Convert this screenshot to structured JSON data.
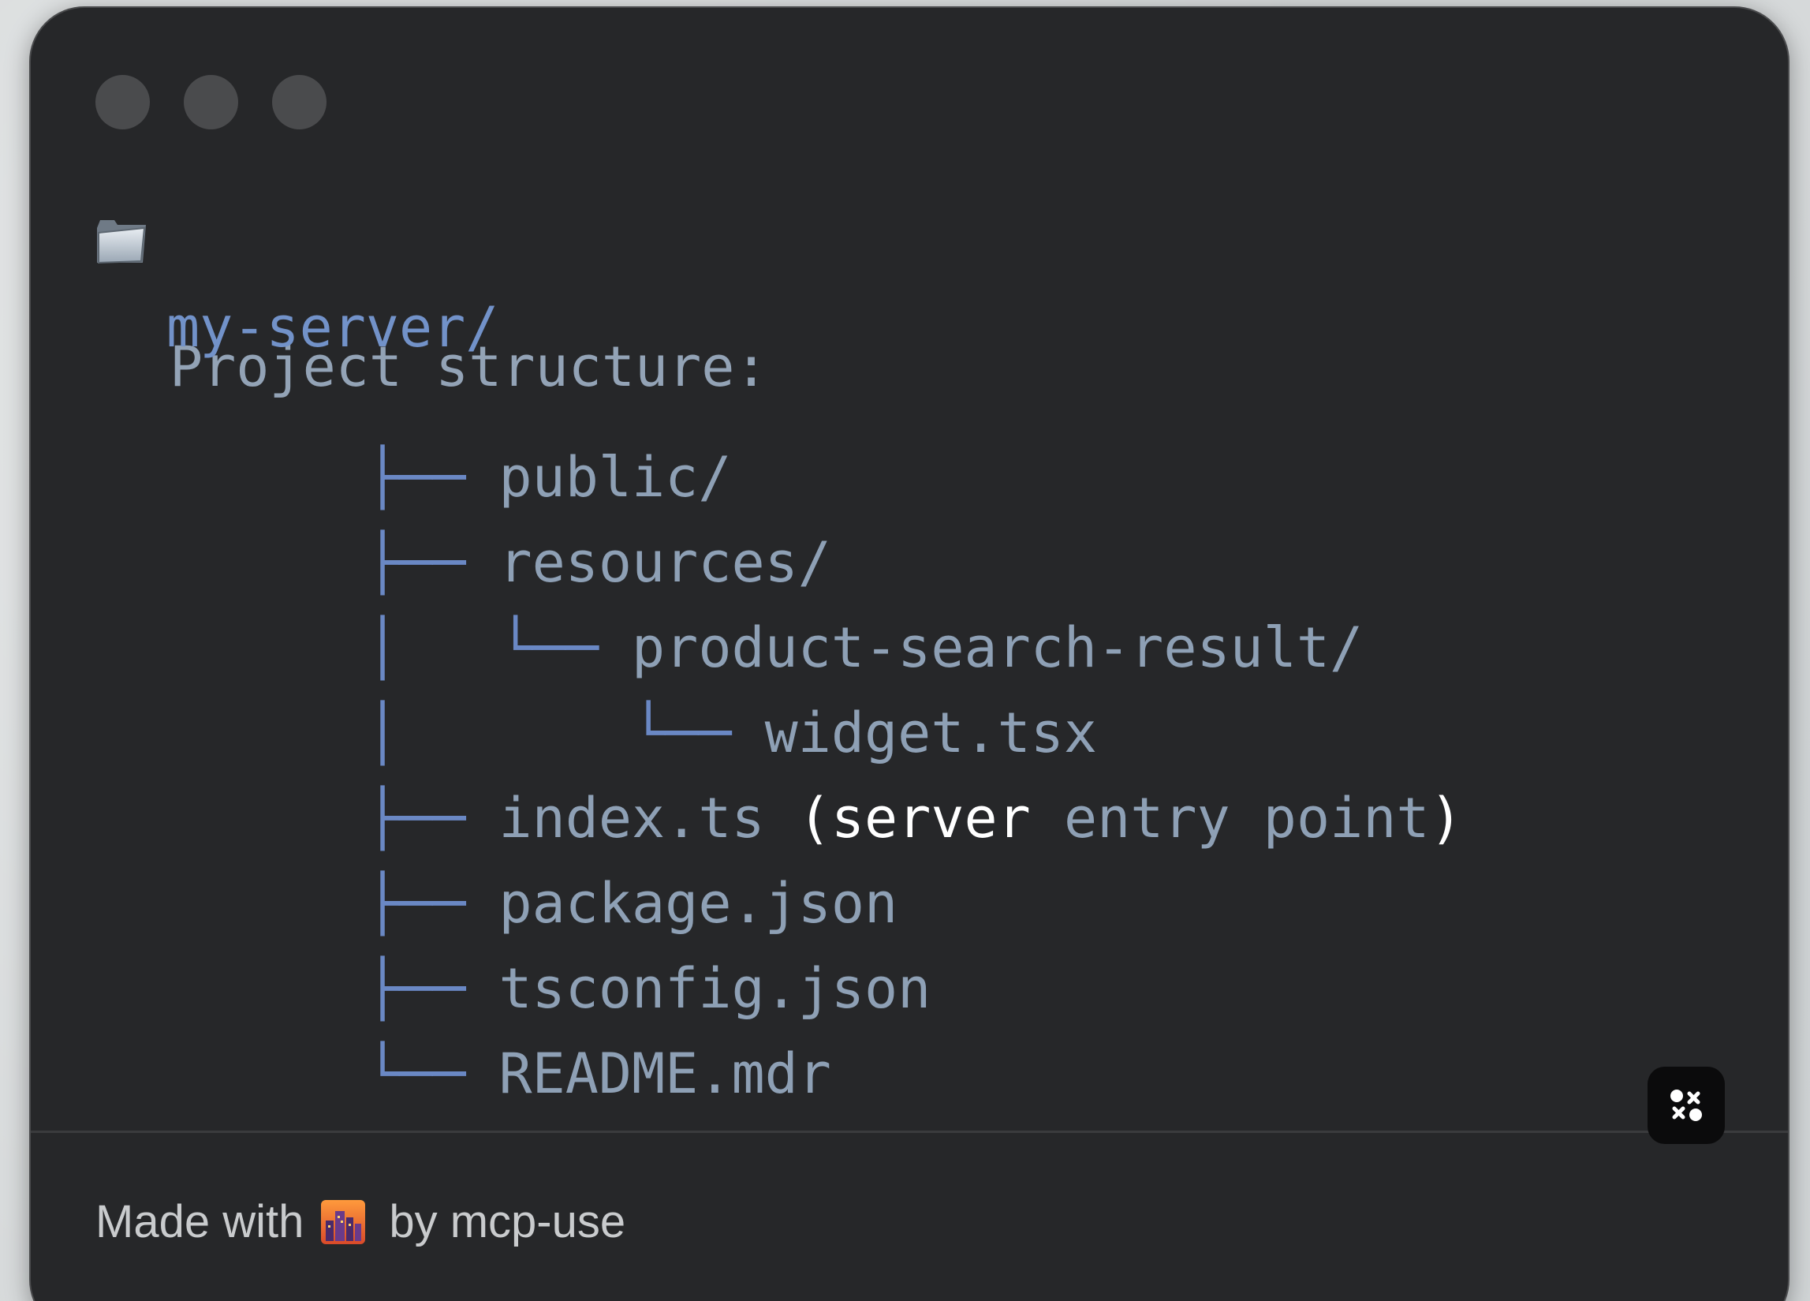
{
  "window": {
    "controls": [
      "close",
      "minimize",
      "zoom"
    ]
  },
  "tree": {
    "heading_icon": "folder-icon",
    "heading": "Project structure:",
    "root": "my-server/",
    "entries": [
      {
        "prefix": "├── ",
        "name": "public/"
      },
      {
        "prefix": "├── ",
        "name": "resources/"
      },
      {
        "prefix": "│   └── ",
        "name": "product-search-result/"
      },
      {
        "prefix": "│       └── ",
        "name": "widget.tsx"
      },
      {
        "prefix": "├── ",
        "name": "index.ts",
        "comment_open": "(server",
        "comment_mid": "entry point",
        "comment_close": ")"
      },
      {
        "prefix": "├── ",
        "name": "package.json"
      },
      {
        "prefix": "├── ",
        "name": "tsconfig.json"
      },
      {
        "prefix": "└── ",
        "name": "README.mdr"
      }
    ]
  },
  "footer": {
    "made_with": "Made with",
    "icon": "cityscape-icon",
    "by": "by mcp-use",
    "logo_icon": "mcp-use-logo-icon"
  },
  "colors": {
    "window_bg": "#262729",
    "branch": "#6a88c4",
    "text": "#8ea0b5",
    "root": "#7292c9"
  }
}
